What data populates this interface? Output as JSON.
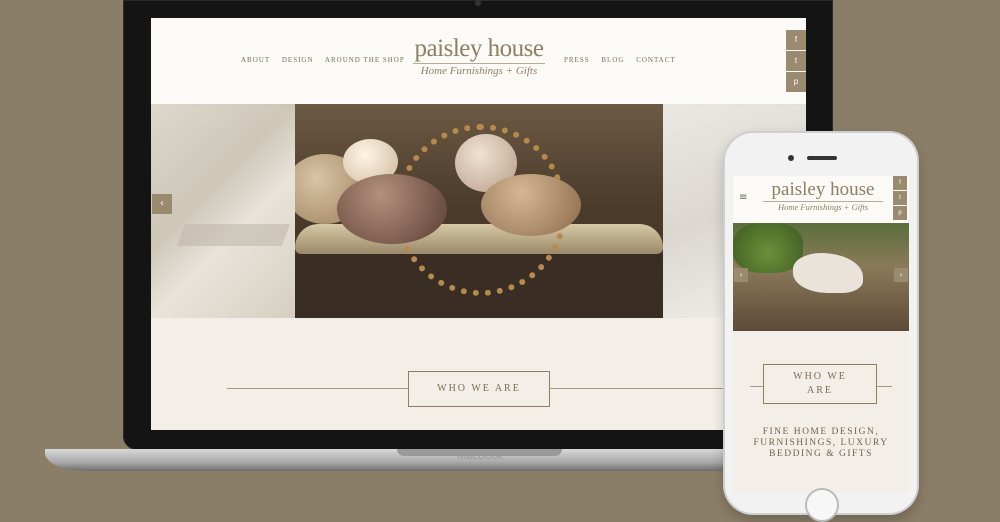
{
  "laptop": {
    "brand": "MacBook",
    "site": {
      "nav_left": [
        "ABOUT",
        "DESIGN",
        "AROUND THE SHOP"
      ],
      "nav_right": [
        "PRESS",
        "BLOG",
        "CONTACT"
      ],
      "logo": {
        "name": "paisley house",
        "tagline": "Home Furnishings + Gifts"
      },
      "social": [
        {
          "icon": "facebook-icon",
          "glyph": "f"
        },
        {
          "icon": "twitter-icon",
          "glyph": "t"
        },
        {
          "icon": "pinterest-icon",
          "glyph": "p"
        }
      ],
      "slider_prev": "‹",
      "section_title": "WHO WE ARE"
    }
  },
  "phone": {
    "site": {
      "menu_glyph": "≡",
      "logo": {
        "name": "paisley house",
        "tagline": "Home Furnishings + Gifts"
      },
      "social": [
        {
          "icon": "facebook-icon",
          "glyph": "f"
        },
        {
          "icon": "twitter-icon",
          "glyph": "t"
        },
        {
          "icon": "pinterest-icon",
          "glyph": "p"
        }
      ],
      "slider_prev": "‹",
      "slider_next": "›",
      "section_title_line1": "WHO WE",
      "section_title_line2": "ARE",
      "tagline_line1": "FINE HOME DESIGN,",
      "tagline_line2": "FURNISHINGS, LUXURY",
      "tagline_line3": "BEDDING & GIFTS"
    }
  },
  "colors": {
    "background": "#8b7e68",
    "brand_taupe": "#9a8b70",
    "text_brown": "#7a6c55"
  }
}
